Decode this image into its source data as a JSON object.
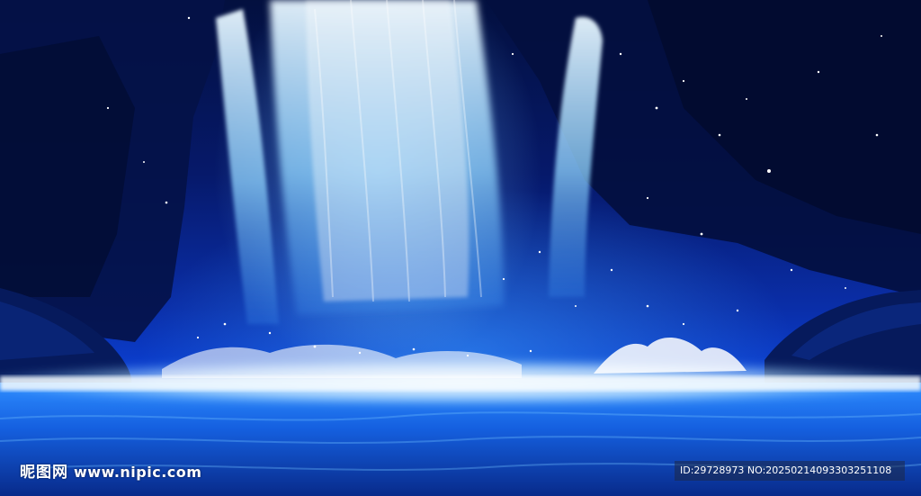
{
  "image": {
    "subject": "blue waterfall cascading into a glowing pool",
    "palette": {
      "deep": "#03103f",
      "mid": "#0a2ea8",
      "glow": "#8fd4ff",
      "foam": "#ffffff"
    }
  },
  "watermark": {
    "site_name": "昵图网",
    "url": "www.nipic.com"
  },
  "id_bar": {
    "text": "ID:29728973 NO:20250214093303251108"
  }
}
